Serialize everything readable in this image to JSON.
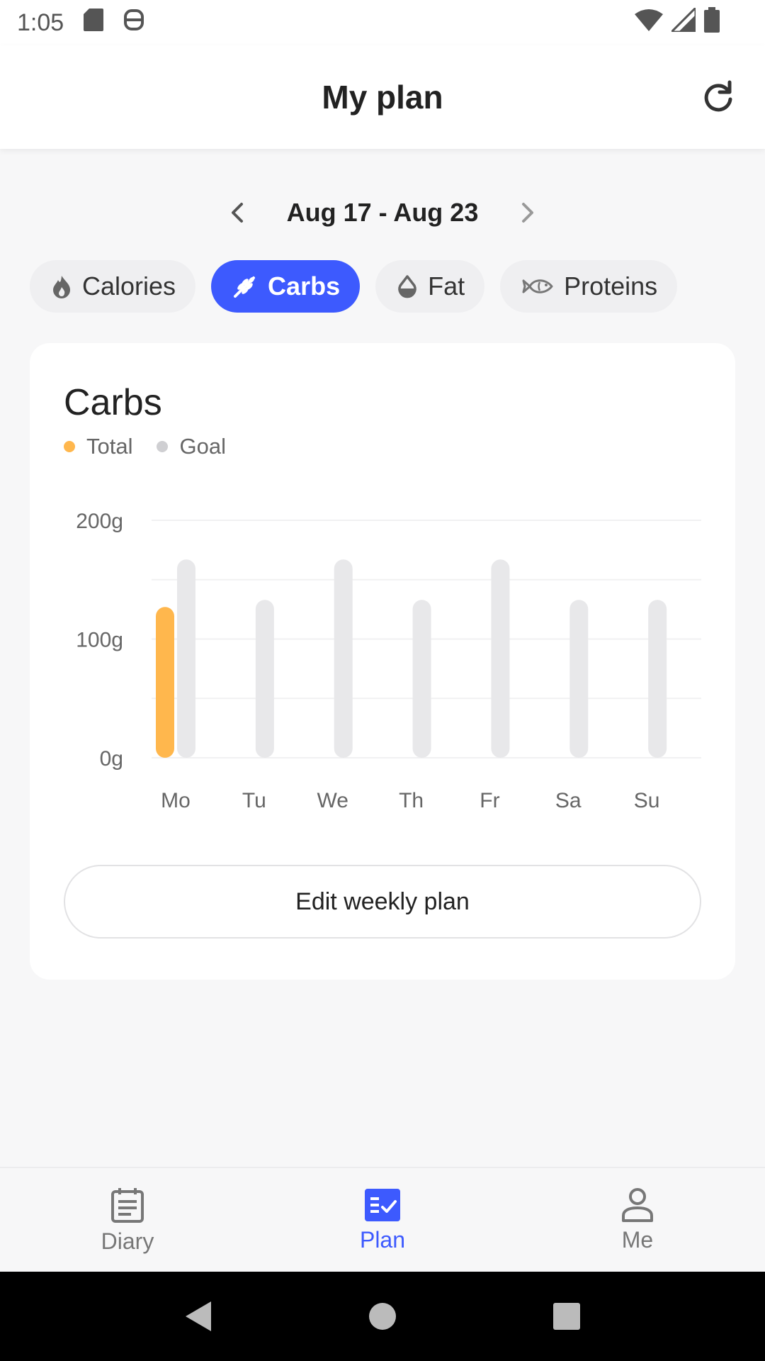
{
  "status_bar": {
    "time": "1:05",
    "icons": [
      "sd-card-icon",
      "lock-icon",
      "wifi-icon",
      "signal-icon",
      "battery-icon"
    ]
  },
  "app_bar": {
    "title": "My plan",
    "refresh_icon": "refresh-icon"
  },
  "week_nav": {
    "label": "Aug 17 - Aug 23",
    "prev_icon": "chevron-left-icon",
    "next_icon": "chevron-right-icon"
  },
  "chips": [
    {
      "label": "Calories",
      "icon": "flame-icon",
      "active": false
    },
    {
      "label": "Carbs",
      "icon": "wheat-icon",
      "active": true
    },
    {
      "label": "Fat",
      "icon": "drop-icon",
      "active": false
    },
    {
      "label": "Proteins",
      "icon": "fish-icon",
      "active": false
    }
  ],
  "card": {
    "title": "Carbs",
    "legend": [
      {
        "label": "Total",
        "color": "#ffb74d"
      },
      {
        "label": "Goal",
        "color": "#cfcfd2"
      }
    ],
    "edit_button_label": "Edit weekly plan"
  },
  "chart_data": {
    "type": "bar",
    "categories": [
      "Mo",
      "Tu",
      "We",
      "Th",
      "Fr",
      "Sa",
      "Su"
    ],
    "series": [
      {
        "name": "Total",
        "values": [
          127,
          0,
          0,
          0,
          0,
          0,
          0
        ],
        "color": "#ffb74d"
      },
      {
        "name": "Goal",
        "values": [
          167,
          133,
          167,
          133,
          167,
          133,
          133
        ],
        "color": "#e8e8ea"
      }
    ],
    "y_ticks": [
      "0g",
      "100g",
      "200g"
    ],
    "ylim": [
      0,
      200
    ],
    "grid": true,
    "legend_placement": "top-left"
  },
  "bottom_nav": [
    {
      "label": "Diary",
      "icon": "diary-icon",
      "active": false
    },
    {
      "label": "Plan",
      "icon": "plan-icon",
      "active": true
    },
    {
      "label": "Me",
      "icon": "profile-icon",
      "active": false
    }
  ],
  "system_nav": [
    "back-icon",
    "home-icon",
    "recents-icon"
  ]
}
